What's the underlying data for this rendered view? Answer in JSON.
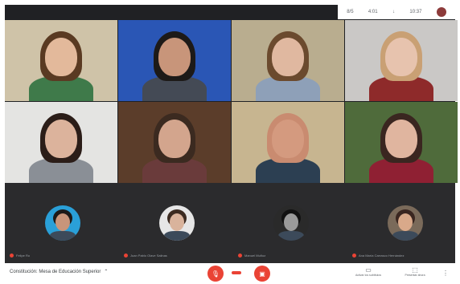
{
  "status_bar": {
    "items": [
      "8/5",
      "4:01",
      "↓",
      "10:37"
    ]
  },
  "participants_grid": [
    {
      "name": "woman-long-hair-shelf",
      "bg": "#cfc3a8",
      "skin": "#e3b99b",
      "hair": "#5a3a22",
      "shirt": "#3f7a4a"
    },
    {
      "name": "man-glasses-blue-curtain",
      "bg": "#2a56b5",
      "skin": "#c8957a",
      "hair": "#1d1a18",
      "shirt": "#444a55"
    },
    {
      "name": "woman-room-window",
      "bg": "#b9ad8f",
      "skin": "#e0b8a0",
      "hair": "#6b4a2e",
      "shirt": "#8ea0b8"
    },
    {
      "name": "woman-blonde-red",
      "bg": "#cac8c6",
      "skin": "#e7c3ae",
      "hair": "#c9a074",
      "shirt": "#8e2a2a"
    },
    {
      "name": "woman-dark-hair-white-wall",
      "bg": "#e4e4e2",
      "skin": "#dcb39c",
      "hair": "#2b1d18",
      "shirt": "#8a8f96"
    },
    {
      "name": "man-dark-wood",
      "bg": "#5b3d2a",
      "skin": "#d3a58d",
      "hair": "#3b2a20",
      "shirt": "#6a3b3b"
    },
    {
      "name": "man-bald-kitchen",
      "bg": "#c7b590",
      "skin": "#d49a7f",
      "hair": "#c98b70",
      "shirt": "#2c3f52"
    },
    {
      "name": "woman-forest-window",
      "bg": "#4f6b3b",
      "skin": "#e0b59f",
      "hair": "#3a2620",
      "shirt": "#8f2033"
    }
  ],
  "thumbnails": [
    {
      "name": "Felipe Ro",
      "skin": "#c8957a",
      "bg": "#2aa0d8",
      "hair": "#1d1a18"
    },
    {
      "name": "Juan Pablo Olave Salinas",
      "skin": "#d9b39c",
      "bg": "#e6e6e6",
      "hair": "#3b2a20"
    },
    {
      "name": "Manuel Muñoz",
      "skin": "#9a9a9a",
      "bg": "#2a2a2a",
      "hair": "#111111"
    },
    {
      "name": "Ana María Carrasco Hernández",
      "skin": "#d9a98a",
      "bg": "#7a6a5a",
      "hair": "#3a2620"
    }
  ],
  "bottom_bar": {
    "meeting_title": "Constitución: Mesa de Educación Superior",
    "mic_icon": "mic-off-icon",
    "camera_icon": "camera-off-icon",
    "present_label": "Presentar ahora",
    "captions_label": "Activar los subtítulos"
  }
}
